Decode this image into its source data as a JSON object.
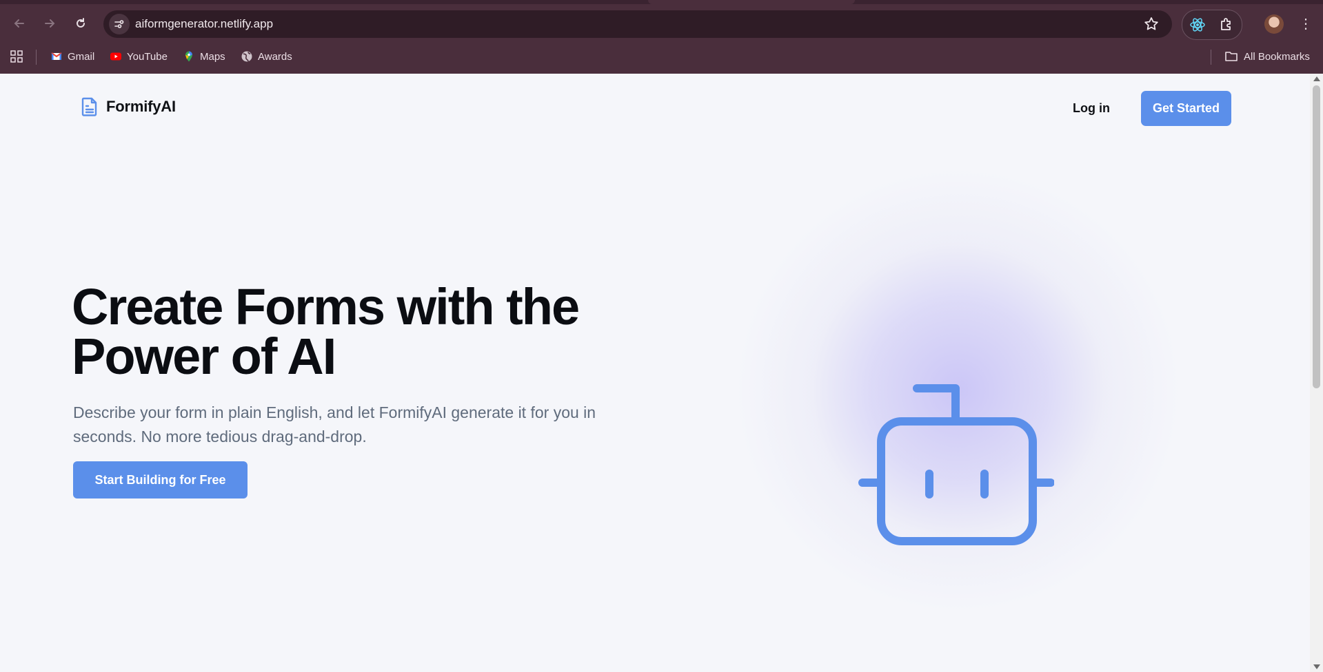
{
  "browser": {
    "url": "aiformgenerator.netlify.app",
    "bookmarks": [
      {
        "label": "Gmail",
        "icon": "gmail-icon"
      },
      {
        "label": "YouTube",
        "icon": "youtube-icon"
      },
      {
        "label": "Maps",
        "icon": "maps-icon"
      },
      {
        "label": "Awards",
        "icon": "globe-icon"
      }
    ],
    "all_bookmarks_label": "All Bookmarks"
  },
  "nav": {
    "brand": "FormifyAI",
    "login_label": "Log in",
    "cta_label": "Get Started"
  },
  "hero": {
    "title_line1": "Create Forms with the",
    "title_line2": "Power of AI",
    "subtitle": "Describe your form in plain English, and let FormifyAI generate it for you in seconds. No more tedious drag-and-drop.",
    "cta_label": "Start Building for Free"
  },
  "colors": {
    "accent": "#5b8fea",
    "chrome": "#4a2e3c",
    "page_bg": "#f5f6fa"
  }
}
